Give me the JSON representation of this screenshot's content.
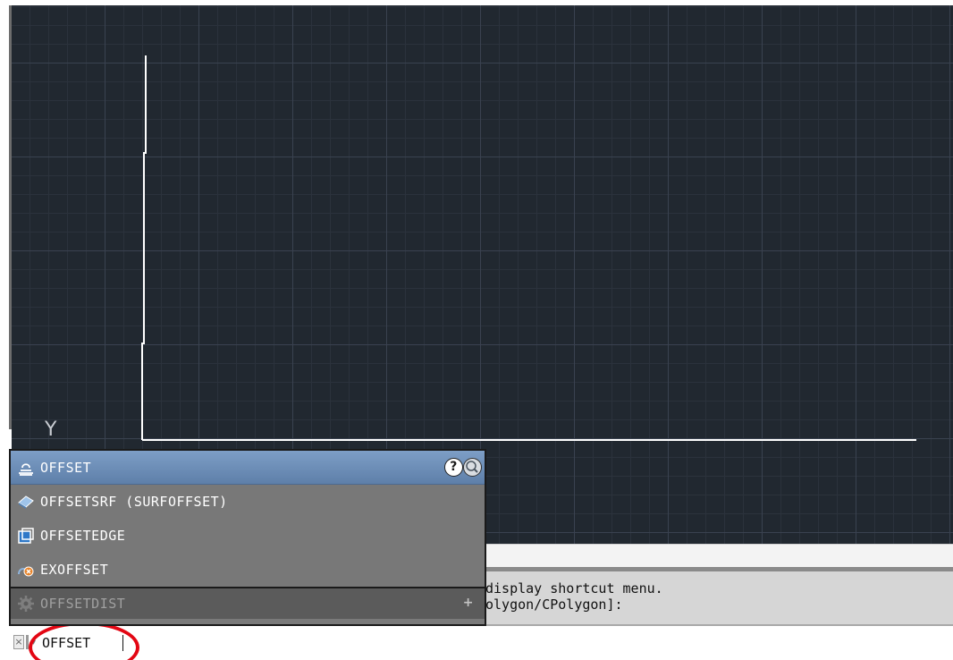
{
  "ucs": {
    "y_label": "Y"
  },
  "autocomplete": {
    "items": [
      {
        "label": "OFFSET",
        "icon": "offset-icon",
        "state": "selected"
      },
      {
        "label": "OFFSETSRF (SURFOFFSET)",
        "icon": "surface-offset-icon",
        "state": "normal"
      },
      {
        "label": "OFFSETEDGE",
        "icon": "offset-edge-icon",
        "state": "normal"
      },
      {
        "label": "EXOFFSET",
        "icon": "express-offset-icon",
        "state": "normal"
      },
      {
        "label": "OFFSETDIST",
        "icon": "system-variable-gear-icon",
        "state": "disabled"
      }
    ],
    "help_symbol": "?",
    "plus_symbol": "+"
  },
  "command_history": {
    "lines": [
      " display shortcut menu.",
      "olygon/CPolygon]:"
    ]
  },
  "command_line": {
    "close_symbol": "×",
    "dropdown_symbol": "▾",
    "input_value": "OFFSET"
  },
  "colors": {
    "viewport_bg": "#212830",
    "selected_item": "#6b8db8",
    "highlight_ellipse": "#e30613",
    "geometry_line": "#ffffff"
  }
}
